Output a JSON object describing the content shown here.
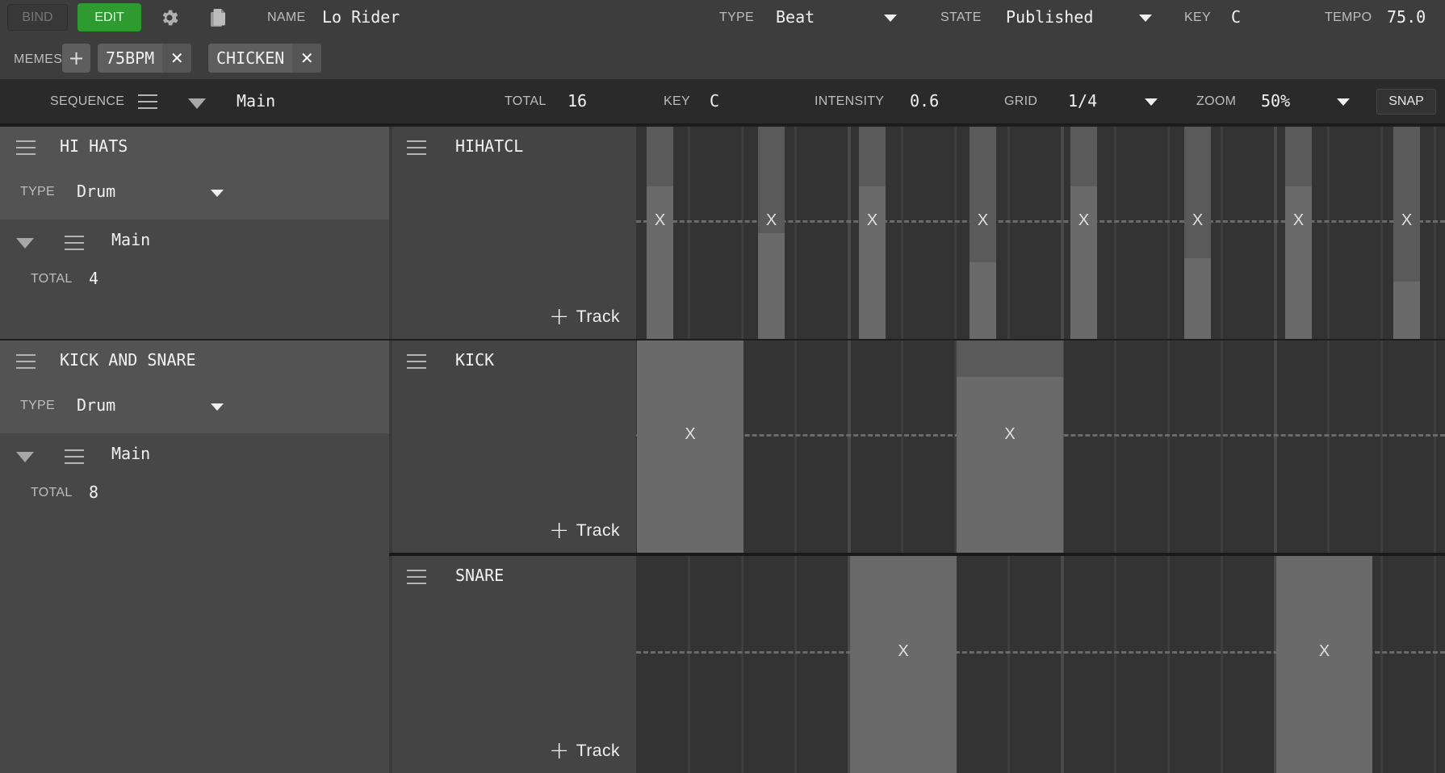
{
  "toolbar": {
    "bind_label": "BIND",
    "edit_label": "EDIT",
    "settings_icon": "gear-icon",
    "copy_icon": "copy-icon",
    "name_label": "NAME",
    "name_value": "Lo Rider",
    "type_label": "TYPE",
    "type_value": "Beat",
    "state_label": "STATE",
    "state_value": "Published",
    "key_label": "KEY",
    "key_value": "C",
    "tempo_label": "TEMPO",
    "tempo_value": "75.0",
    "accent_color": "#2e9b30"
  },
  "memes": {
    "label": "MEMES",
    "add_label": "+",
    "items": [
      {
        "label": "75BPM",
        "remove": "✕"
      },
      {
        "label": "CHICKEN",
        "remove": "✕"
      }
    ]
  },
  "sequence": {
    "label": "SEQUENCE",
    "value": "Main",
    "total_label": "TOTAL",
    "total_value": "16",
    "key_label": "KEY",
    "key_value": "C",
    "intensity_label": "INTENSITY",
    "intensity_value": "0.6",
    "grid_label": "GRID",
    "grid_value": "1/4",
    "zoom_label": "ZOOM",
    "zoom_value": "50%",
    "snap_label": "SNAP"
  },
  "voices": [
    {
      "name": "HI HATS",
      "type_label": "TYPE",
      "type_value": "Drum",
      "pattern_name": "Main",
      "total_label": "TOTAL",
      "total_value": "4",
      "tracks": [
        {
          "name": "HIHATCL",
          "add_track_label": "Track",
          "notes": [
            {
              "start_beat": 0.045,
              "length_beat": 0.125,
              "velocity": 0.72,
              "label": "X"
            },
            {
              "start_beat": 0.57,
              "length_beat": 0.125,
              "velocity": 0.5,
              "label": "X"
            },
            {
              "start_beat": 1.04,
              "length_beat": 0.125,
              "velocity": 0.72,
              "label": "X"
            },
            {
              "start_beat": 1.56,
              "length_beat": 0.125,
              "velocity": 0.36,
              "label": "X"
            },
            {
              "start_beat": 2.035,
              "length_beat": 0.125,
              "velocity": 0.72,
              "label": "X"
            },
            {
              "start_beat": 2.57,
              "length_beat": 0.125,
              "velocity": 0.38,
              "label": "X"
            },
            {
              "start_beat": 3.04,
              "length_beat": 0.125,
              "velocity": 0.72,
              "label": "X"
            },
            {
              "start_beat": 3.55,
              "length_beat": 0.125,
              "velocity": 0.27,
              "label": "X"
            }
          ]
        }
      ]
    },
    {
      "name": "KICK AND SNARE",
      "type_label": "TYPE",
      "type_value": "Drum",
      "pattern_name": "Main",
      "total_label": "TOTAL",
      "total_value": "8",
      "tracks": [
        {
          "name": "KICK",
          "add_track_label": "Track",
          "notes": [
            {
              "start_beat": 0,
              "length_beat": 0.5,
              "velocity": 1.0,
              "label": "X"
            },
            {
              "start_beat": 1.5,
              "length_beat": 0.5,
              "velocity": 0.83,
              "label": "X"
            }
          ]
        },
        {
          "name": "SNARE",
          "add_track_label": "Track",
          "notes": [
            {
              "start_beat": 1.0,
              "length_beat": 0.5,
              "velocity": 1.0,
              "label": "X"
            },
            {
              "start_beat": 3.0,
              "length_beat": 0.45,
              "velocity": 1.0,
              "label": "X"
            }
          ]
        }
      ]
    }
  ]
}
